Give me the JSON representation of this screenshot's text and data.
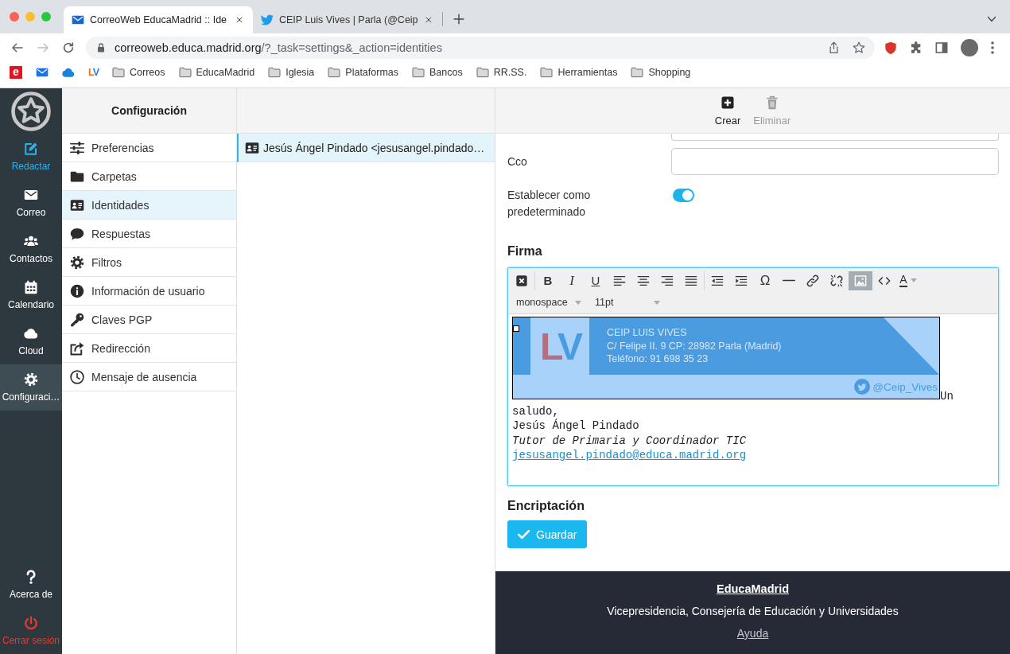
{
  "browser": {
    "tabs": [
      {
        "title": "CorreoWeb EducaMadrid :: Ide",
        "kind": "mail",
        "selected": true
      },
      {
        "title": "CEIP Luis Vives | Parla (@Ceip",
        "kind": "bird",
        "selected": false
      }
    ],
    "address": {
      "host": "correoweb.educa.madrid.org",
      "path": "/?_task=settings&_action=identities"
    },
    "bookmark_icons": [
      {
        "kind": "letter",
        "text": "e"
      },
      {
        "kind": "mail"
      },
      {
        "kind": "cloud"
      },
      {
        "kind": "logo",
        "text": "LV"
      }
    ],
    "bookmark_folders": [
      "Correos",
      "EducaMadrid",
      "Iglesia",
      "Plataformas",
      "Bancos",
      "RR.SS.",
      "Herramientas",
      "Shopping"
    ]
  },
  "nav": {
    "items": [
      {
        "label": "Redactar",
        "kind": "compose",
        "selected": false
      },
      {
        "label": "Correo",
        "kind": "mail",
        "selected": false
      },
      {
        "label": "Contactos",
        "kind": "contacts",
        "selected": false
      },
      {
        "label": "Calendario",
        "kind": "calendar",
        "selected": false
      },
      {
        "label": "Cloud",
        "kind": "cloud",
        "selected": false
      },
      {
        "label": "Configuraci…",
        "kind": "settings",
        "selected": true
      }
    ],
    "bottom": [
      {
        "label": "Acerca de",
        "kind": "about"
      },
      {
        "label": "Cerrar sesión",
        "kind": "logout"
      }
    ]
  },
  "settings_menu": {
    "title": "Configuración",
    "items": [
      {
        "label": "Preferencias",
        "kind": "preferences",
        "selected": false
      },
      {
        "label": "Carpetas",
        "kind": "folders",
        "selected": false
      },
      {
        "label": "Identidades",
        "kind": "identities",
        "selected": true
      },
      {
        "label": "Respuestas",
        "kind": "responses",
        "selected": false
      },
      {
        "label": "Filtros",
        "kind": "filters",
        "selected": false
      },
      {
        "label": "Información de usuario",
        "kind": "user-info",
        "selected": false
      },
      {
        "label": "Claves PGP",
        "kind": "pgp",
        "selected": false
      },
      {
        "label": "Redirección",
        "kind": "redirect",
        "selected": false
      },
      {
        "label": "Mensaje de ausencia",
        "kind": "vacation",
        "selected": false
      }
    ]
  },
  "identities": [
    {
      "text": "Jesús Ángel Pindado <jesusangel.pindado…",
      "selected": true
    }
  ],
  "toolbar": [
    {
      "label": "Crear",
      "kind": "create",
      "disabled": false
    },
    {
      "label": "Eliminar",
      "kind": "delete",
      "disabled": true
    }
  ],
  "form": {
    "fields": [
      {
        "kind": "cut-off"
      },
      {
        "kind": "text",
        "label": "Cco"
      },
      {
        "kind": "toggle",
        "label": "Establecer como predeterminado",
        "on": true
      }
    ],
    "signature_heading": "Firma",
    "editor": {
      "toolbar_groups": [
        [
          {
            "kind": "clear",
            "active": false
          }
        ],
        [
          {
            "kind": "bold",
            "text": "B",
            "active": false
          },
          {
            "kind": "italic",
            "text": "I",
            "active": false
          },
          {
            "kind": "underline",
            "text": "U",
            "active": false
          },
          {
            "kind": "align-left",
            "active": false
          },
          {
            "kind": "align-center",
            "active": false
          },
          {
            "kind": "align-right",
            "active": false
          },
          {
            "kind": "justify",
            "active": false
          }
        ],
        [
          {
            "kind": "outdent",
            "active": false
          },
          {
            "kind": "indent",
            "active": false
          },
          {
            "kind": "special-char",
            "text": "Ω",
            "active": false
          },
          {
            "kind": "rule",
            "active": false
          },
          {
            "kind": "link",
            "active": false
          },
          {
            "kind": "unlink",
            "active": false
          },
          {
            "kind": "image",
            "active": true
          },
          {
            "kind": "code",
            "active": false
          },
          {
            "kind": "text-color",
            "text": "A",
            "active": false
          }
        ]
      ],
      "font_family": "monospace",
      "font_size": "11pt",
      "image": {
        "selected": true,
        "logo": "LV",
        "lines": [
          "CEIP LUIS VIVES",
          "C/ Felipe II. 9 CP: 28982 Parla (Madrid)",
          "Teléfono: 91 698 35 23"
        ],
        "handle": "@Ceip_Vives"
      },
      "lines": [
        {
          "kind": "plain",
          "text": "Un"
        },
        {
          "kind": "plain",
          "text": "saludo,"
        },
        {
          "kind": "plain",
          "text": "Jesús Ángel Pindado"
        },
        {
          "kind": "italic",
          "text": "Tutor de Primaria y Coordinador TIC"
        },
        {
          "kind": "link",
          "text": "jesusangel.pindado@educa.madrid.org"
        }
      ]
    },
    "next_heading": "Encriptación",
    "save_button": "Guardar"
  },
  "footer": {
    "title": "EducaMadrid",
    "text": "Vicepresidencia, Consejería de Educación y Universidades",
    "link": "Ayuda"
  }
}
